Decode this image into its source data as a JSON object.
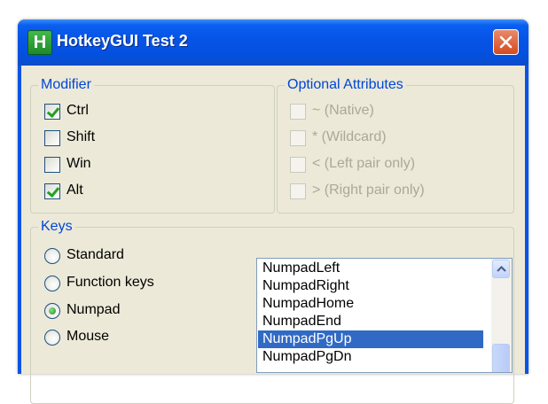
{
  "window": {
    "app_icon_letter": "H",
    "title": "HotkeyGUI Test 2"
  },
  "modifier": {
    "title": "Modifier",
    "items": [
      {
        "label": "Ctrl",
        "checked": true
      },
      {
        "label": "Shift",
        "checked": false
      },
      {
        "label": "Win",
        "checked": false
      },
      {
        "label": "Alt",
        "checked": true
      }
    ]
  },
  "optional": {
    "title": "Optional Attributes",
    "items": [
      {
        "label": "~ (Native)",
        "checked": false,
        "enabled": false
      },
      {
        "label": "* (Wildcard)",
        "checked": false,
        "enabled": false
      },
      {
        "label": "< (Left pair only)",
        "checked": false,
        "enabled": false
      },
      {
        "label": "> (Right pair only)",
        "checked": false,
        "enabled": false
      }
    ]
  },
  "keys": {
    "title": "Keys",
    "radios": [
      {
        "label": "Standard",
        "checked": false
      },
      {
        "label": "Function keys",
        "checked": false
      },
      {
        "label": "Numpad",
        "checked": true
      },
      {
        "label": "Mouse",
        "checked": false
      }
    ],
    "list": {
      "items": [
        "NumpadLeft",
        "NumpadRight",
        "NumpadHome",
        "NumpadEnd",
        "NumpadPgUp",
        "NumpadPgDn"
      ],
      "selected": "NumpadPgUp"
    }
  },
  "colors": {
    "title_bar": "#0054e3",
    "group_title": "#0046d5",
    "selection": "#316ac5",
    "client_bg": "#ece9d8"
  }
}
